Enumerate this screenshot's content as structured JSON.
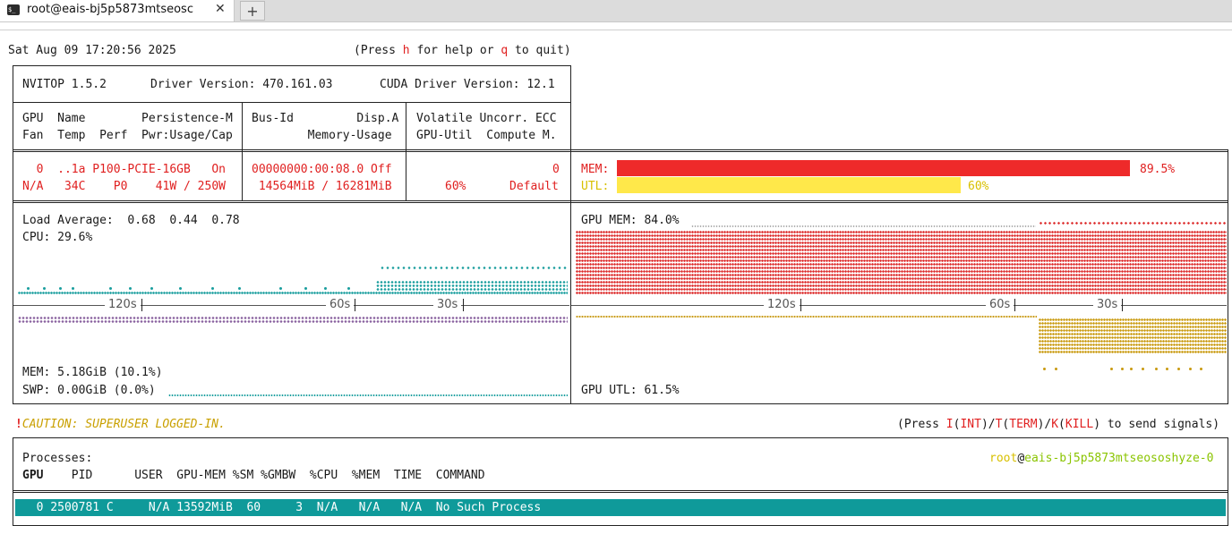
{
  "tab": {
    "title": "root@eais-bj5p5873mtseosc",
    "close": "✕",
    "new_tab": "+"
  },
  "header": {
    "datetime": "Sat Aug 09 17:20:56 2025",
    "help_prefix": "(Press ",
    "help_key": "h",
    "help_mid": " for help or ",
    "quit_key": "q",
    "help_suffix": " to quit)"
  },
  "info": {
    "nvitop": "NVITOP 1.5.2",
    "driver": "Driver Version: 470.161.03",
    "cuda": "CUDA Driver Version: 12.1"
  },
  "columns": {
    "c1_line1": "GPU  Name        Persistence-M",
    "c1_line2": "Fan  Temp  Perf  Pwr:Usage/Cap",
    "c2_line1": "Bus-Id         Disp.A",
    "c2_line2": "        Memory-Usage",
    "c3_line1": "Volatile Uncorr. ECC",
    "c3_line2": "GPU-Util  Compute M."
  },
  "gpu": {
    "line1_left": "  0  ..1a P100-PCIE-16GB   On",
    "line2_left": "N/A   34C    P0    41W / 250W",
    "line1_mid": "00000000:00:08.0 Off",
    "line2_mid": " 14564MiB / 16281MiB",
    "line1_right": "0",
    "line2_util": "60%",
    "line2_compute": "Default",
    "mem_label": "MEM:",
    "mem_value": "89.5%",
    "mem_fraction": 0.895,
    "utl_label": "UTL:",
    "utl_value": "60%",
    "utl_fraction": 0.6
  },
  "host": {
    "load_average": "Load Average:  0.68  0.44  0.78",
    "cpu": "CPU: 29.6%",
    "mem": "MEM: 5.18GiB (10.1%)",
    "swp": "SWP: 0.00GiB (0.0%)",
    "tick_120": "120s",
    "tick_60": "60s",
    "tick_30": "30s"
  },
  "gpu_graph": {
    "mem": "GPU MEM: 84.0%",
    "utl": "GPU UTL: 61.5%",
    "tick_120": "120s",
    "tick_60": "60s",
    "tick_30": "30s"
  },
  "caution": {
    "bang": "!",
    "text": "CAUTION: SUPERUSER LOGGED-IN.",
    "signals_prefix": "(Press ",
    "int_key": "I",
    "int_label": "INT",
    "term_key": "T",
    "term_label": "TERM",
    "kill_key": "K",
    "kill_label": "KILL",
    "signals_suffix": " to send signals)"
  },
  "processes": {
    "title": "Processes:",
    "user_host_user": "root",
    "user_host_at": "@",
    "user_host_host": "eais-bj5p5873mtseososhyze-0",
    "headers": {
      "gpu": "GPU",
      "rest": "    PID      USER  GPU-MEM %SM %GMBW  %CPU  %MEM  TIME  COMMAND"
    },
    "row": "  0 2500781 C     N/A 13592MiB  60     3  N/A   N/A   N/A  No Such Process"
  },
  "colors": {
    "mem_bar": "#ee2a2a",
    "utl_bar": "#ffe84a",
    "cpu_teal": "#1a9e9e",
    "mem_purple": "#8a63a0",
    "gpu_mem_red": "#dd2a2a",
    "gpu_utl_gold": "#c99a10",
    "process_row": "#0f9a9a"
  },
  "icons": {
    "tab_icon": "terminal-icon"
  }
}
